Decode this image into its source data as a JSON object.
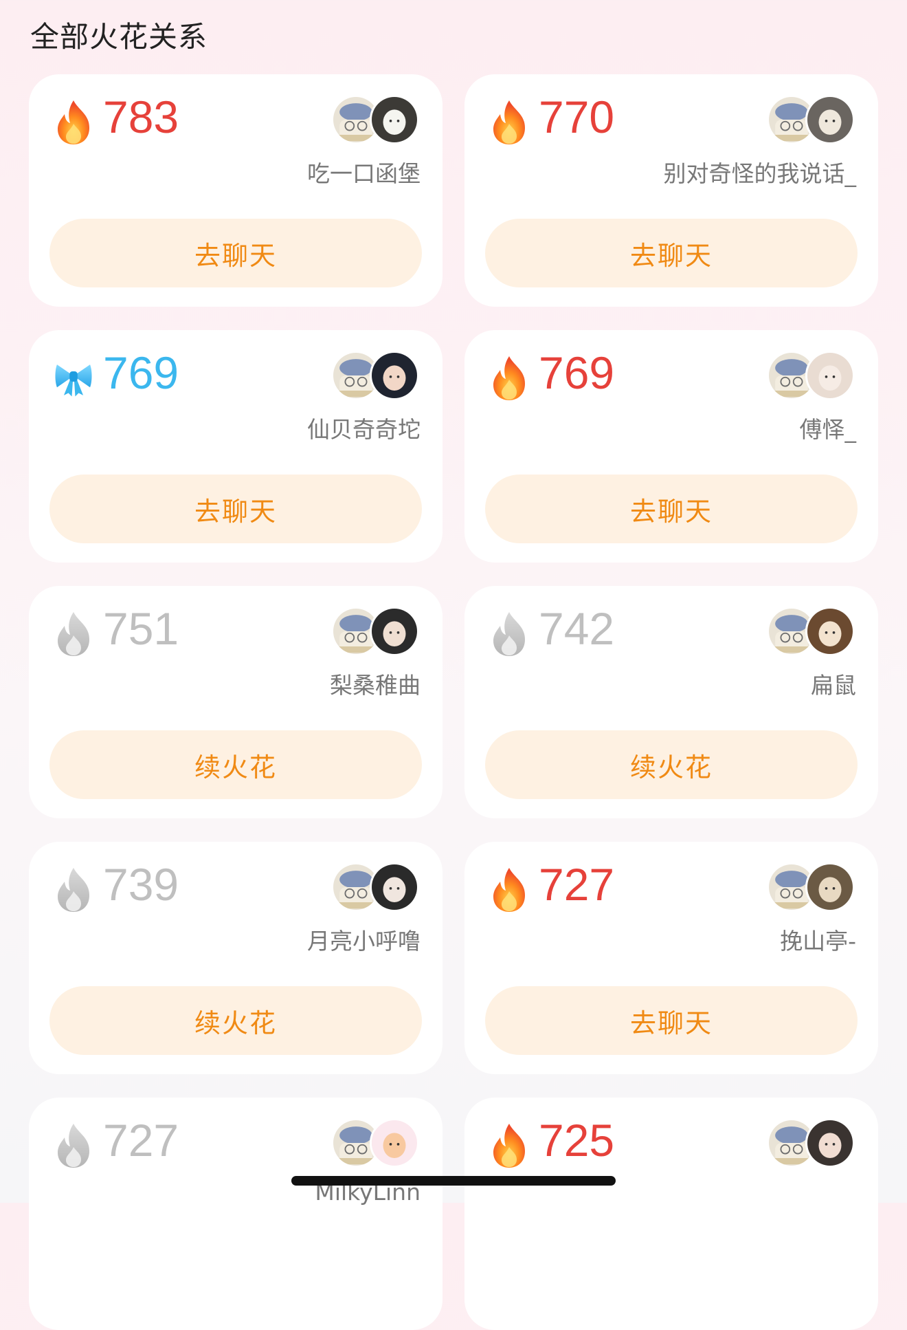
{
  "header": {
    "title": "全部火花关系"
  },
  "colors": {
    "fire": "#e6413a",
    "bow": "#3bb7ee",
    "cold": "#bfbfbf",
    "action_text": "#f08a14",
    "action_bg": "#fef1e2"
  },
  "cards": [
    {
      "score": "783",
      "icon": "flame-icon",
      "state": "fire",
      "name": "吃一口函堡",
      "action": "去聊天"
    },
    {
      "score": "770",
      "icon": "flame-icon",
      "state": "fire",
      "name": "别对奇怪的我说话_",
      "action": "去聊天"
    },
    {
      "score": "769",
      "icon": "bow-icon",
      "state": "bow",
      "name": "仙贝奇奇坨",
      "action": "去聊天"
    },
    {
      "score": "769",
      "icon": "flame-icon",
      "state": "fire",
      "name": "傅怿_",
      "action": "去聊天"
    },
    {
      "score": "751",
      "icon": "gray-flame-icon",
      "state": "cold",
      "name": "梨桑稚曲",
      "action": "续火花"
    },
    {
      "score": "742",
      "icon": "gray-flame-icon",
      "state": "cold",
      "name": "扁鼠",
      "action": "续火花"
    },
    {
      "score": "739",
      "icon": "gray-flame-icon",
      "state": "cold",
      "name": "月亮小呼噜",
      "action": "续火花"
    },
    {
      "score": "727",
      "icon": "flame-icon",
      "state": "fire",
      "name": "挽山亭-",
      "action": "去聊天"
    },
    {
      "score": "727",
      "icon": "gray-flame-icon",
      "state": "cold",
      "name": "MilkyLinn",
      "action": ""
    },
    {
      "score": "725",
      "icon": "flame-icon",
      "state": "fire",
      "name": "",
      "action": ""
    }
  ]
}
